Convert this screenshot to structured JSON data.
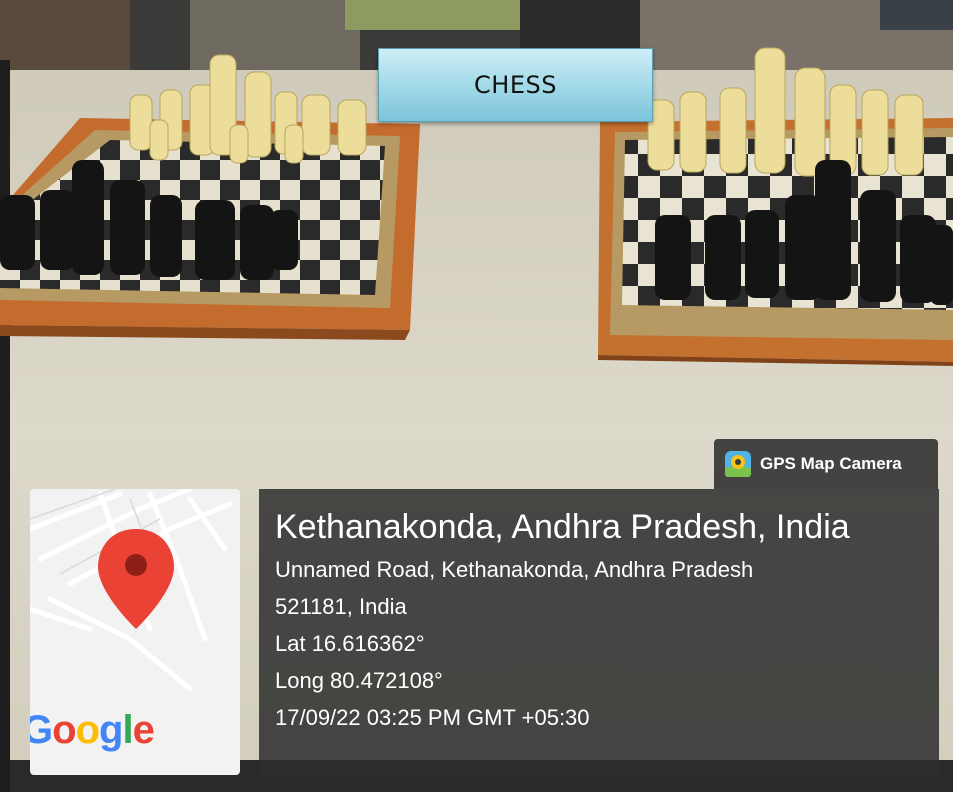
{
  "overlay": {
    "title": "CHESS"
  },
  "gps_badge": {
    "label": "GPS Map Camera",
    "icon": "gps-map-camera-icon"
  },
  "map": {
    "logo_letters": [
      "G",
      "o",
      "o",
      "g",
      "l",
      "e"
    ],
    "logo_colors": [
      "#4285F4",
      "#EA4335",
      "#FBBC05",
      "#4285F4",
      "#34A853",
      "#EA4335"
    ],
    "pin_color": "#EA4335",
    "pin_icon": "map-pin-icon"
  },
  "location": {
    "place": "Kethanakonda, Andhra Pradesh, India",
    "address_line1": "Unnamed Road, Kethanakonda, Andhra Pradesh",
    "address_line2": "521181, India",
    "latitude": "Lat 16.616362°",
    "longitude": "Long 80.472108°",
    "timestamp": "17/09/22 03:25 PM GMT +05:30"
  },
  "colors": {
    "panel_bg": "#2d2d2d",
    "title_box": "#9fd8e8",
    "table": "#ddd8c9",
    "board_frame": "#c86c2c"
  }
}
